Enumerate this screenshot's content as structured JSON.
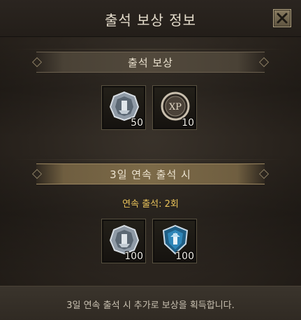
{
  "window": {
    "title": "출석 보상 정보",
    "close_icon": "close-x-icon"
  },
  "daily_reward": {
    "header": "출석 보상",
    "items": [
      {
        "icon": "silver-medal-icon",
        "quantity": "50"
      },
      {
        "icon": "xp-coin-icon",
        "quantity": "10"
      }
    ]
  },
  "streak_reward": {
    "header": "3일 연속 출석 시",
    "streak_status": "연속 출석: 2회",
    "items": [
      {
        "icon": "silver-medal-icon",
        "quantity": "100"
      },
      {
        "icon": "blue-shield-emblem-icon",
        "quantity": "100"
      }
    ]
  },
  "footer": {
    "note": "3일 연속 출석 시 추가로 보상을 획득합니다."
  },
  "colors": {
    "streak_text": "#e8c25a",
    "banner_gold": "#7c6a48"
  }
}
